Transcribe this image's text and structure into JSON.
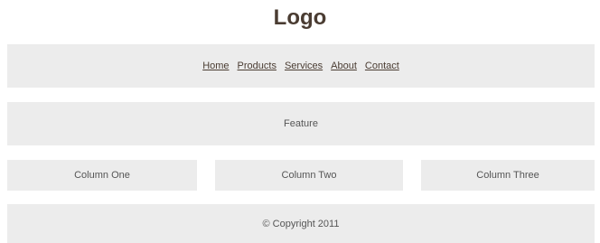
{
  "header": {
    "logo": "Logo"
  },
  "nav": {
    "items": [
      {
        "label": "Home"
      },
      {
        "label": "Products"
      },
      {
        "label": "Services"
      },
      {
        "label": "About"
      },
      {
        "label": "Contact"
      }
    ]
  },
  "feature": {
    "label": "Feature"
  },
  "columns": [
    {
      "label": "Column One"
    },
    {
      "label": "Column Two"
    },
    {
      "label": "Column Three"
    }
  ],
  "footer": {
    "copyright": "© Copyright 2011"
  },
  "colors": {
    "band_background": "#ececec",
    "logo_text": "#4a3c32",
    "link_text": "#4a3c32",
    "body_text": "#555555"
  }
}
